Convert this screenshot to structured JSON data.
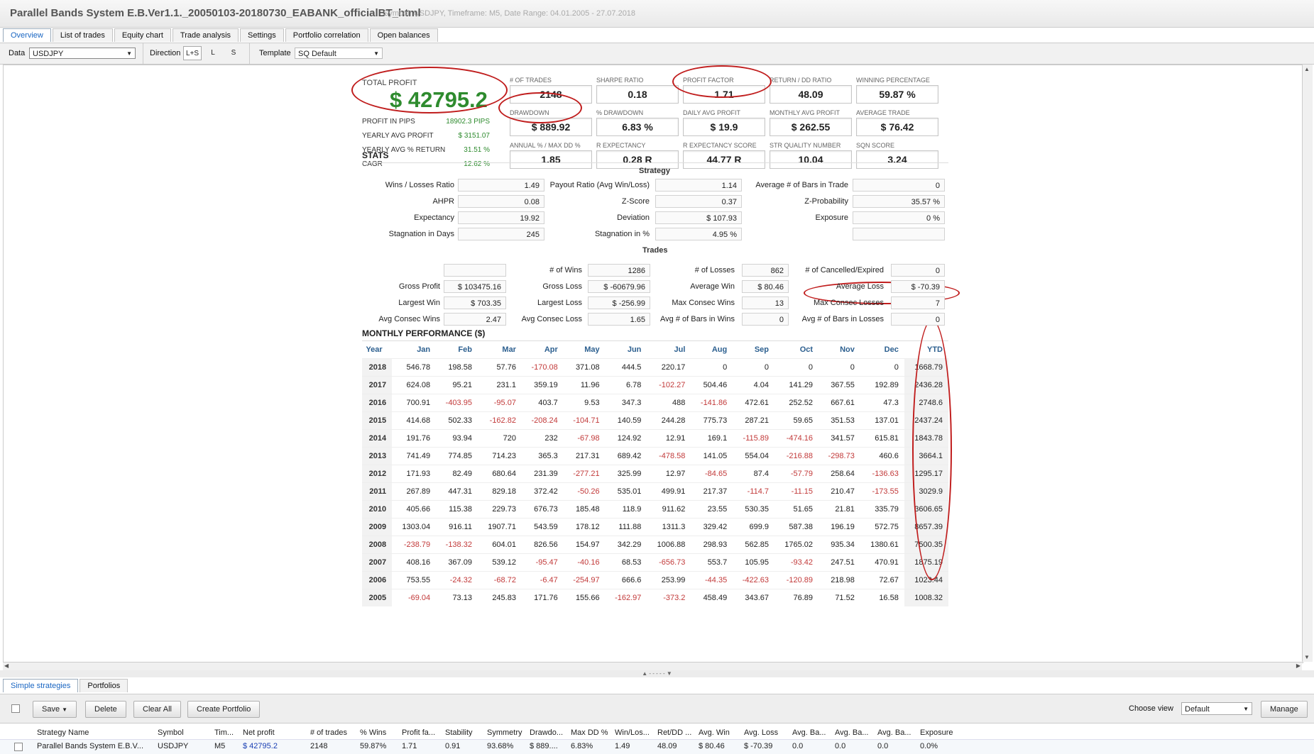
{
  "window": {
    "title": "Parallel Bands System E.B.Ver1.1._20050103-20180730_EABANK_officialBT_html",
    "subtitle": "Symbol: USDJPY, Timeframe: M5, Date Range: 04.01.2005 - 27.07.2018"
  },
  "tabs": [
    "Overview",
    "List of trades",
    "Equity chart",
    "Trade analysis",
    "Settings",
    "Portfolio correlation",
    "Open balances"
  ],
  "toolbar": {
    "data_label": "Data",
    "data_value": "USDJPY",
    "direction_label": "Direction",
    "directions": [
      "L+S",
      "L",
      "S"
    ],
    "template_label": "Template",
    "template_value": "SQ Default"
  },
  "summary": {
    "total_profit_label": "TOTAL PROFIT",
    "total_profit_value": "$ 42795.2",
    "side": [
      {
        "label": "PROFIT IN PIPS",
        "value": "18902.3 PIPS"
      },
      {
        "label": "YEARLY AVG PROFIT",
        "value": "$ 3151.07"
      },
      {
        "label": "YEARLY AVG % RETURN",
        "value": "31.51 %"
      },
      {
        "label": "CAGR",
        "value": "12.62 %"
      }
    ],
    "kpis": [
      {
        "label": "# OF TRADES",
        "value": "2148"
      },
      {
        "label": "SHARPE RATIO",
        "value": "0.18"
      },
      {
        "label": "PROFIT FACTOR",
        "value": "1.71"
      },
      {
        "label": "RETURN / DD RATIO",
        "value": "48.09"
      },
      {
        "label": "WINNING PERCENTAGE",
        "value": "59.87 %"
      },
      {
        "label": "DRAWDOWN",
        "value": "$ 889.92"
      },
      {
        "label": "% DRAWDOWN",
        "value": "6.83 %"
      },
      {
        "label": "DAILY AVG PROFIT",
        "value": "$ 19.9"
      },
      {
        "label": "MONTHLY AVG PROFIT",
        "value": "$ 262.55"
      },
      {
        "label": "AVERAGE TRADE",
        "value": "$ 76.42"
      },
      {
        "label": "ANNUAL % / MAX DD %",
        "value": "1.85"
      },
      {
        "label": "R EXPECTANCY",
        "value": "0.28 R"
      },
      {
        "label": "R EXPECTANCY SCORE",
        "value": "44.77 R"
      },
      {
        "label": "STR QUALITY NUMBER",
        "value": "10.04"
      },
      {
        "label": "SQN SCORE",
        "value": "3.24"
      }
    ]
  },
  "stats": {
    "title": "STATS",
    "strategy_title": "Strategy",
    "strategy": [
      [
        {
          "label": "Wins / Losses Ratio",
          "value": "1.49"
        },
        {
          "label": "Payout Ratio (Avg Win/Loss)",
          "value": "1.14"
        },
        {
          "label": "Average # of Bars in Trade",
          "value": "0"
        }
      ],
      [
        {
          "label": "AHPR",
          "value": "0.08"
        },
        {
          "label": "Z-Score",
          "value": "0.37"
        },
        {
          "label": "Z-Probability",
          "value": "35.57 %"
        }
      ],
      [
        {
          "label": "Expectancy",
          "value": "19.92"
        },
        {
          "label": "Deviation",
          "value": "$ 107.93"
        },
        {
          "label": "Exposure",
          "value": "0 %"
        }
      ],
      [
        {
          "label": "Stagnation in Days",
          "value": "245"
        },
        {
          "label": "Stagnation in %",
          "value": "4.95 %"
        },
        {
          "label": "",
          "value": ""
        }
      ]
    ],
    "trades_title": "Trades",
    "trades": [
      [
        {
          "label": "",
          "value": ""
        },
        {
          "label": "# of Wins",
          "value": "1286"
        },
        {
          "label": "# of Losses",
          "value": "862"
        },
        {
          "label": "# of Cancelled/Expired",
          "value": "0"
        }
      ],
      [
        {
          "label": "Gross Profit",
          "value": "$ 103475.16"
        },
        {
          "label": "Gross Loss",
          "value": "$ -60679.96"
        },
        {
          "label": "Average Win",
          "value": "$ 80.46"
        },
        {
          "label": "Average Loss",
          "value": "$ -70.39"
        }
      ],
      [
        {
          "label": "Largest Win",
          "value": "$ 703.35"
        },
        {
          "label": "Largest Loss",
          "value": "$ -256.99"
        },
        {
          "label": "Max Consec Wins",
          "value": "13"
        },
        {
          "label": "Max Consec Losses",
          "value": "7"
        }
      ],
      [
        {
          "label": "Avg Consec Wins",
          "value": "2.47"
        },
        {
          "label": "Avg Consec Loss",
          "value": "1.65"
        },
        {
          "label": "Avg # of Bars in Wins",
          "value": "0"
        },
        {
          "label": "Avg # of Bars in Losses",
          "value": "0"
        }
      ]
    ]
  },
  "monthly": {
    "title": "MONTHLY PERFORMANCE ($)",
    "headers": [
      "Year",
      "Jan",
      "Feb",
      "Mar",
      "Apr",
      "May",
      "Jun",
      "Jul",
      "Aug",
      "Sep",
      "Oct",
      "Nov",
      "Dec",
      "YTD"
    ],
    "rows": [
      [
        "2018",
        "546.78",
        "198.58",
        "57.76",
        "-170.08",
        "371.08",
        "444.5",
        "220.17",
        "0",
        "0",
        "0",
        "0",
        "0",
        "1668.79"
      ],
      [
        "2017",
        "624.08",
        "95.21",
        "231.1",
        "359.19",
        "11.96",
        "6.78",
        "-102.27",
        "504.46",
        "4.04",
        "141.29",
        "367.55",
        "192.89",
        "2436.28"
      ],
      [
        "2016",
        "700.91",
        "-403.95",
        "-95.07",
        "403.7",
        "9.53",
        "347.3",
        "488",
        "-141.86",
        "472.61",
        "252.52",
        "667.61",
        "47.3",
        "2748.6"
      ],
      [
        "2015",
        "414.68",
        "502.33",
        "-162.82",
        "-208.24",
        "-104.71",
        "140.59",
        "244.28",
        "775.73",
        "287.21",
        "59.65",
        "351.53",
        "137.01",
        "2437.24"
      ],
      [
        "2014",
        "191.76",
        "93.94",
        "720",
        "232",
        "-67.98",
        "124.92",
        "12.91",
        "169.1",
        "-115.89",
        "-474.16",
        "341.57",
        "615.81",
        "1843.78"
      ],
      [
        "2013",
        "741.49",
        "774.85",
        "714.23",
        "365.3",
        "217.31",
        "689.42",
        "-478.58",
        "141.05",
        "554.04",
        "-216.88",
        "-298.73",
        "460.6",
        "3664.1"
      ],
      [
        "2012",
        "171.93",
        "82.49",
        "680.64",
        "231.39",
        "-277.21",
        "325.99",
        "12.97",
        "-84.65",
        "87.4",
        "-57.79",
        "258.64",
        "-136.63",
        "1295.17"
      ],
      [
        "2011",
        "267.89",
        "447.31",
        "829.18",
        "372.42",
        "-50.26",
        "535.01",
        "499.91",
        "217.37",
        "-114.7",
        "-11.15",
        "210.47",
        "-173.55",
        "3029.9"
      ],
      [
        "2010",
        "405.66",
        "115.38",
        "229.73",
        "676.73",
        "185.48",
        "118.9",
        "911.62",
        "23.55",
        "530.35",
        "51.65",
        "21.81",
        "335.79",
        "3606.65"
      ],
      [
        "2009",
        "1303.04",
        "916.11",
        "1907.71",
        "543.59",
        "178.12",
        "111.88",
        "1311.3",
        "329.42",
        "699.9",
        "587.38",
        "196.19",
        "572.75",
        "8657.39"
      ],
      [
        "2008",
        "-238.79",
        "-138.32",
        "604.01",
        "826.56",
        "154.97",
        "342.29",
        "1006.88",
        "298.93",
        "562.85",
        "1765.02",
        "935.34",
        "1380.61",
        "7500.35"
      ],
      [
        "2007",
        "408.16",
        "367.09",
        "539.12",
        "-95.47",
        "-40.16",
        "68.53",
        "-656.73",
        "553.7",
        "105.95",
        "-93.42",
        "247.51",
        "470.91",
        "1875.19"
      ],
      [
        "2006",
        "753.55",
        "-24.32",
        "-68.72",
        "-6.47",
        "-254.97",
        "666.6",
        "253.99",
        "-44.35",
        "-422.63",
        "-120.89",
        "218.98",
        "72.67",
        "1023.44"
      ],
      [
        "2005",
        "-69.04",
        "73.13",
        "245.83",
        "171.76",
        "155.66",
        "-162.97",
        "-373.2",
        "458.49",
        "343.67",
        "76.89",
        "71.52",
        "16.58",
        "1008.32"
      ]
    ]
  },
  "bottom": {
    "tabs": [
      "Simple strategies",
      "Portfolios"
    ],
    "buttons": {
      "save": "Save",
      "delete": "Delete",
      "clear_all": "Clear All",
      "create_portfolio": "Create Portfolio",
      "manage": "Manage"
    },
    "choose_view_label": "Choose view",
    "view_value": "Default",
    "columns": [
      "Strategy Name",
      "Symbol",
      "Tim...",
      "Net profit",
      "# of trades",
      "% Wins",
      "Profit fa...",
      "Stability",
      "Symmetry",
      "Drawdo...",
      "Max DD %",
      "Win/Los...",
      "Ret/DD ...",
      "Avg. Win",
      "Avg. Loss",
      "Avg. Ba...",
      "Avg. Ba...",
      "Avg. Ba...",
      "Exposure"
    ],
    "row": [
      "Parallel Bands System E.B.V...",
      "USDJPY",
      "M5",
      "$ 42795.2",
      "2148",
      "59.87%",
      "1.71",
      "0.91",
      "93.68%",
      "$ 889....",
      "6.83%",
      "1.49",
      "48.09",
      "$ 80.46",
      "$ -70.39",
      "0.0",
      "0.0",
      "0.0",
      "0.0%"
    ]
  },
  "colors": {
    "profit_green": "#2e8b2e",
    "negative_red": "#c23a3a",
    "annotation_red": "#c01d1d",
    "header_blue": "#2c5f8f",
    "active_tab": "#1a66c2"
  }
}
